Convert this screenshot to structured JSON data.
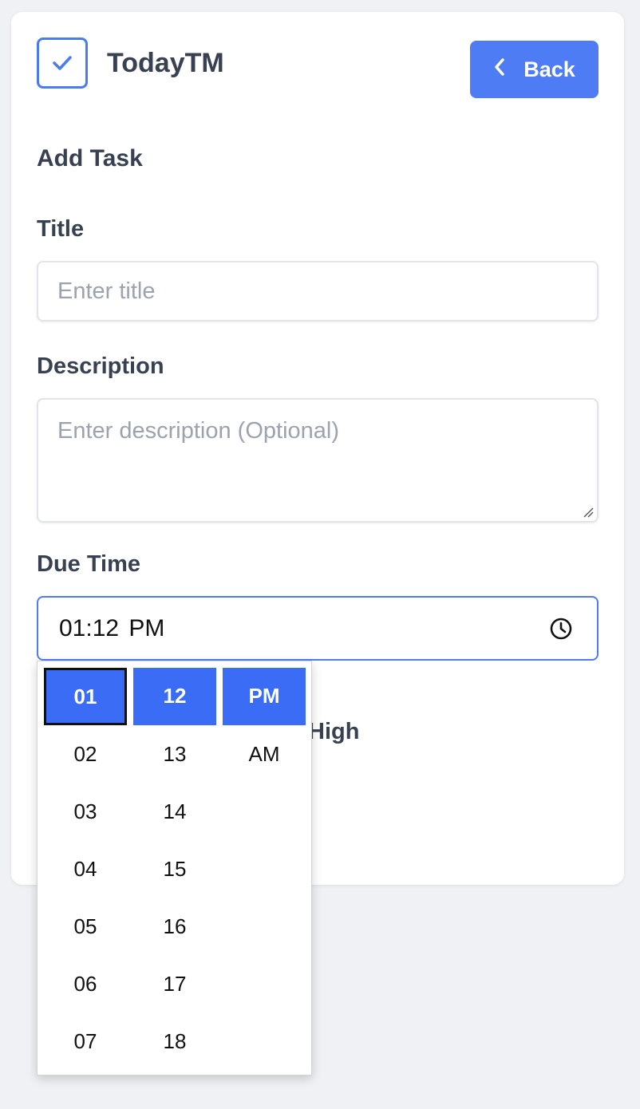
{
  "app": {
    "title": "TodayTM"
  },
  "header": {
    "back_label": "Back"
  },
  "form": {
    "section_title": "Add Task",
    "title_label": "Title",
    "title_placeholder": "Enter title",
    "description_label": "Description",
    "description_placeholder": "Enter description (Optional)",
    "due_time_label": "Due Time",
    "due_time_value": "01:12 PM",
    "priority_visible_option": "High"
  },
  "time_picker": {
    "hours": [
      "01",
      "02",
      "03",
      "04",
      "05",
      "06",
      "07"
    ],
    "minutes": [
      "12",
      "13",
      "14",
      "15",
      "16",
      "17",
      "18"
    ],
    "periods": [
      "PM",
      "AM"
    ],
    "selected": {
      "hour": "01",
      "minute": "12",
      "period": "PM"
    }
  },
  "colors": {
    "accent": "#4d7cf5",
    "selected_option": "#3a6cf5",
    "background": "#f0f1f4",
    "text": "#374151",
    "placeholder": "#9ca3af"
  },
  "icons": {
    "logo": "checkbox-check-icon",
    "back": "chevron-left-icon",
    "clock": "clock-icon",
    "resize": "resize-grip-icon"
  }
}
